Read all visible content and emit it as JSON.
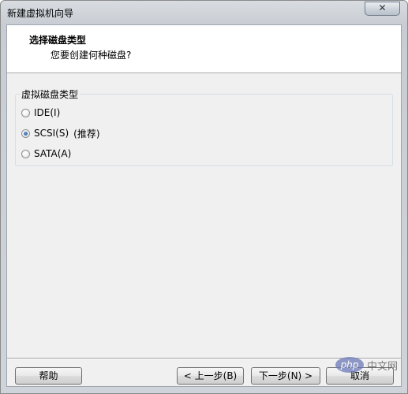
{
  "window": {
    "title": "新建虚拟机向导",
    "close_glyph": "✕"
  },
  "header": {
    "title": "选择磁盘类型",
    "subtitle": "您要创建何种磁盘?"
  },
  "disk_type_group": {
    "label": "虚拟磁盘类型",
    "options": [
      {
        "label": "IDE(I)",
        "checked": false
      },
      {
        "label": "SCSI(S)",
        "checked": true,
        "note": "(推荐)"
      },
      {
        "label": "SATA(A)",
        "checked": false
      }
    ]
  },
  "buttons": {
    "help": "帮助",
    "back": "< 上一步(B)",
    "next": "下一步(N) >",
    "cancel": "取消"
  },
  "watermark": {
    "badge": "php",
    "text": "中文网"
  }
}
